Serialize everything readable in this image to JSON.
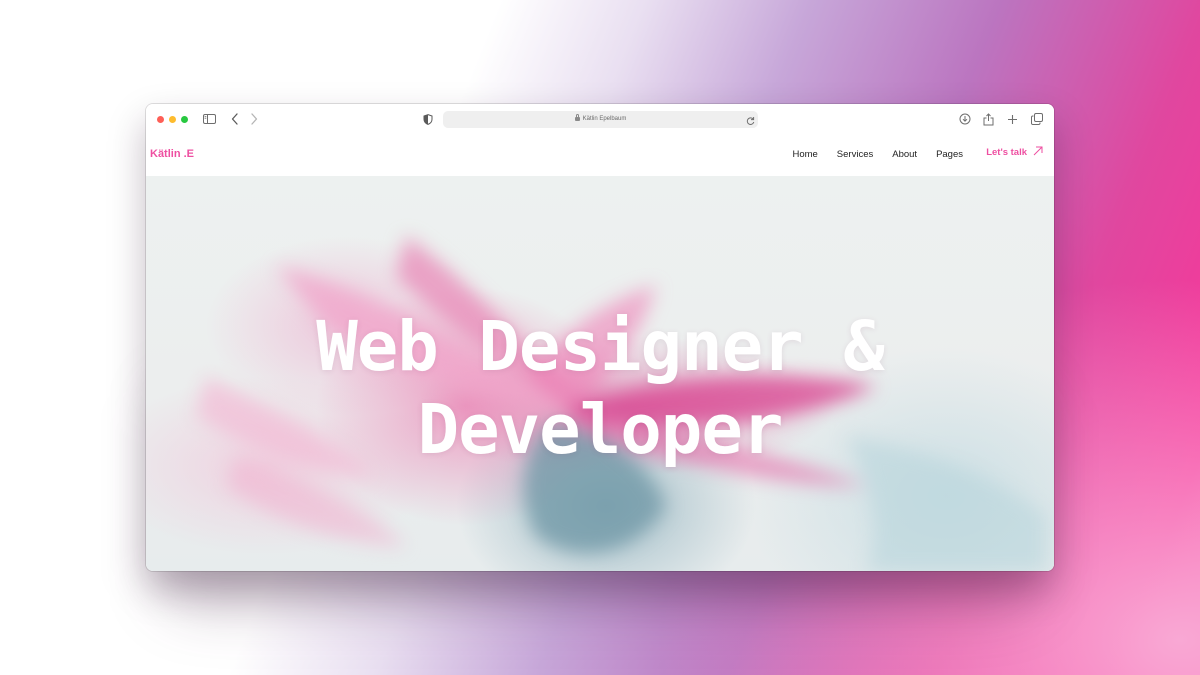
{
  "browser": {
    "url_text": "Kätlin Epelbaum",
    "colors": {
      "close": "#fe5f57",
      "minimize": "#febc2e",
      "zoom": "#28c840"
    },
    "icons": [
      "sidebar-icon",
      "back-icon",
      "forward-icon",
      "shield-icon",
      "lock-icon",
      "reload-icon",
      "download-icon",
      "share-icon",
      "new-tab-icon",
      "tabs-overview-icon"
    ]
  },
  "site": {
    "logo": "Kätlin .E",
    "nav": {
      "home": "Home",
      "services": "Services",
      "about": "About",
      "pages": "Pages"
    },
    "cta": {
      "label": "Let's talk",
      "icon": "arrow-up-right-icon"
    },
    "accent_color": "#ee4fa1"
  },
  "hero": {
    "headline_line1": "Web Designer &",
    "headline_line2": "Developer"
  }
}
